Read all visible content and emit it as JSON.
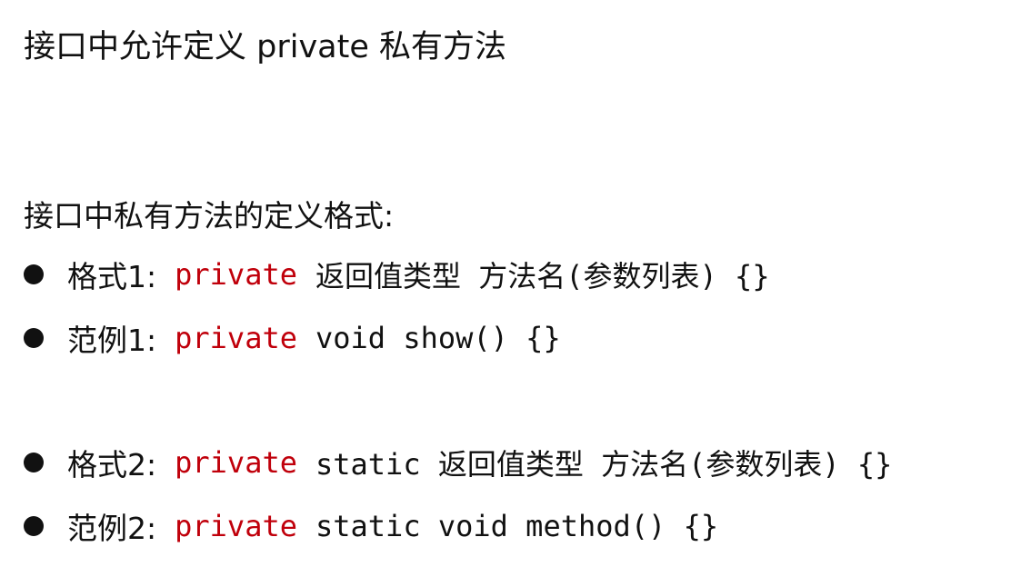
{
  "title": "接口中允许定义 private 私有方法",
  "subtitle": "接口中私有方法的定义格式:",
  "colors": {
    "keyword": "#c0000b",
    "text": "#111111",
    "background": "#ffffff"
  },
  "items": [
    {
      "label": "格式1:",
      "keyword": "private",
      "code": "返回值类型 方法名(参数列表) {}"
    },
    {
      "label": "范例1:",
      "keyword": "private",
      "code": "void show() {}"
    },
    {
      "label": "格式2:",
      "keyword": "private",
      "code": "static 返回值类型 方法名(参数列表) {}"
    },
    {
      "label": "范例2:",
      "keyword": "private",
      "code": "static void method() {}"
    }
  ]
}
